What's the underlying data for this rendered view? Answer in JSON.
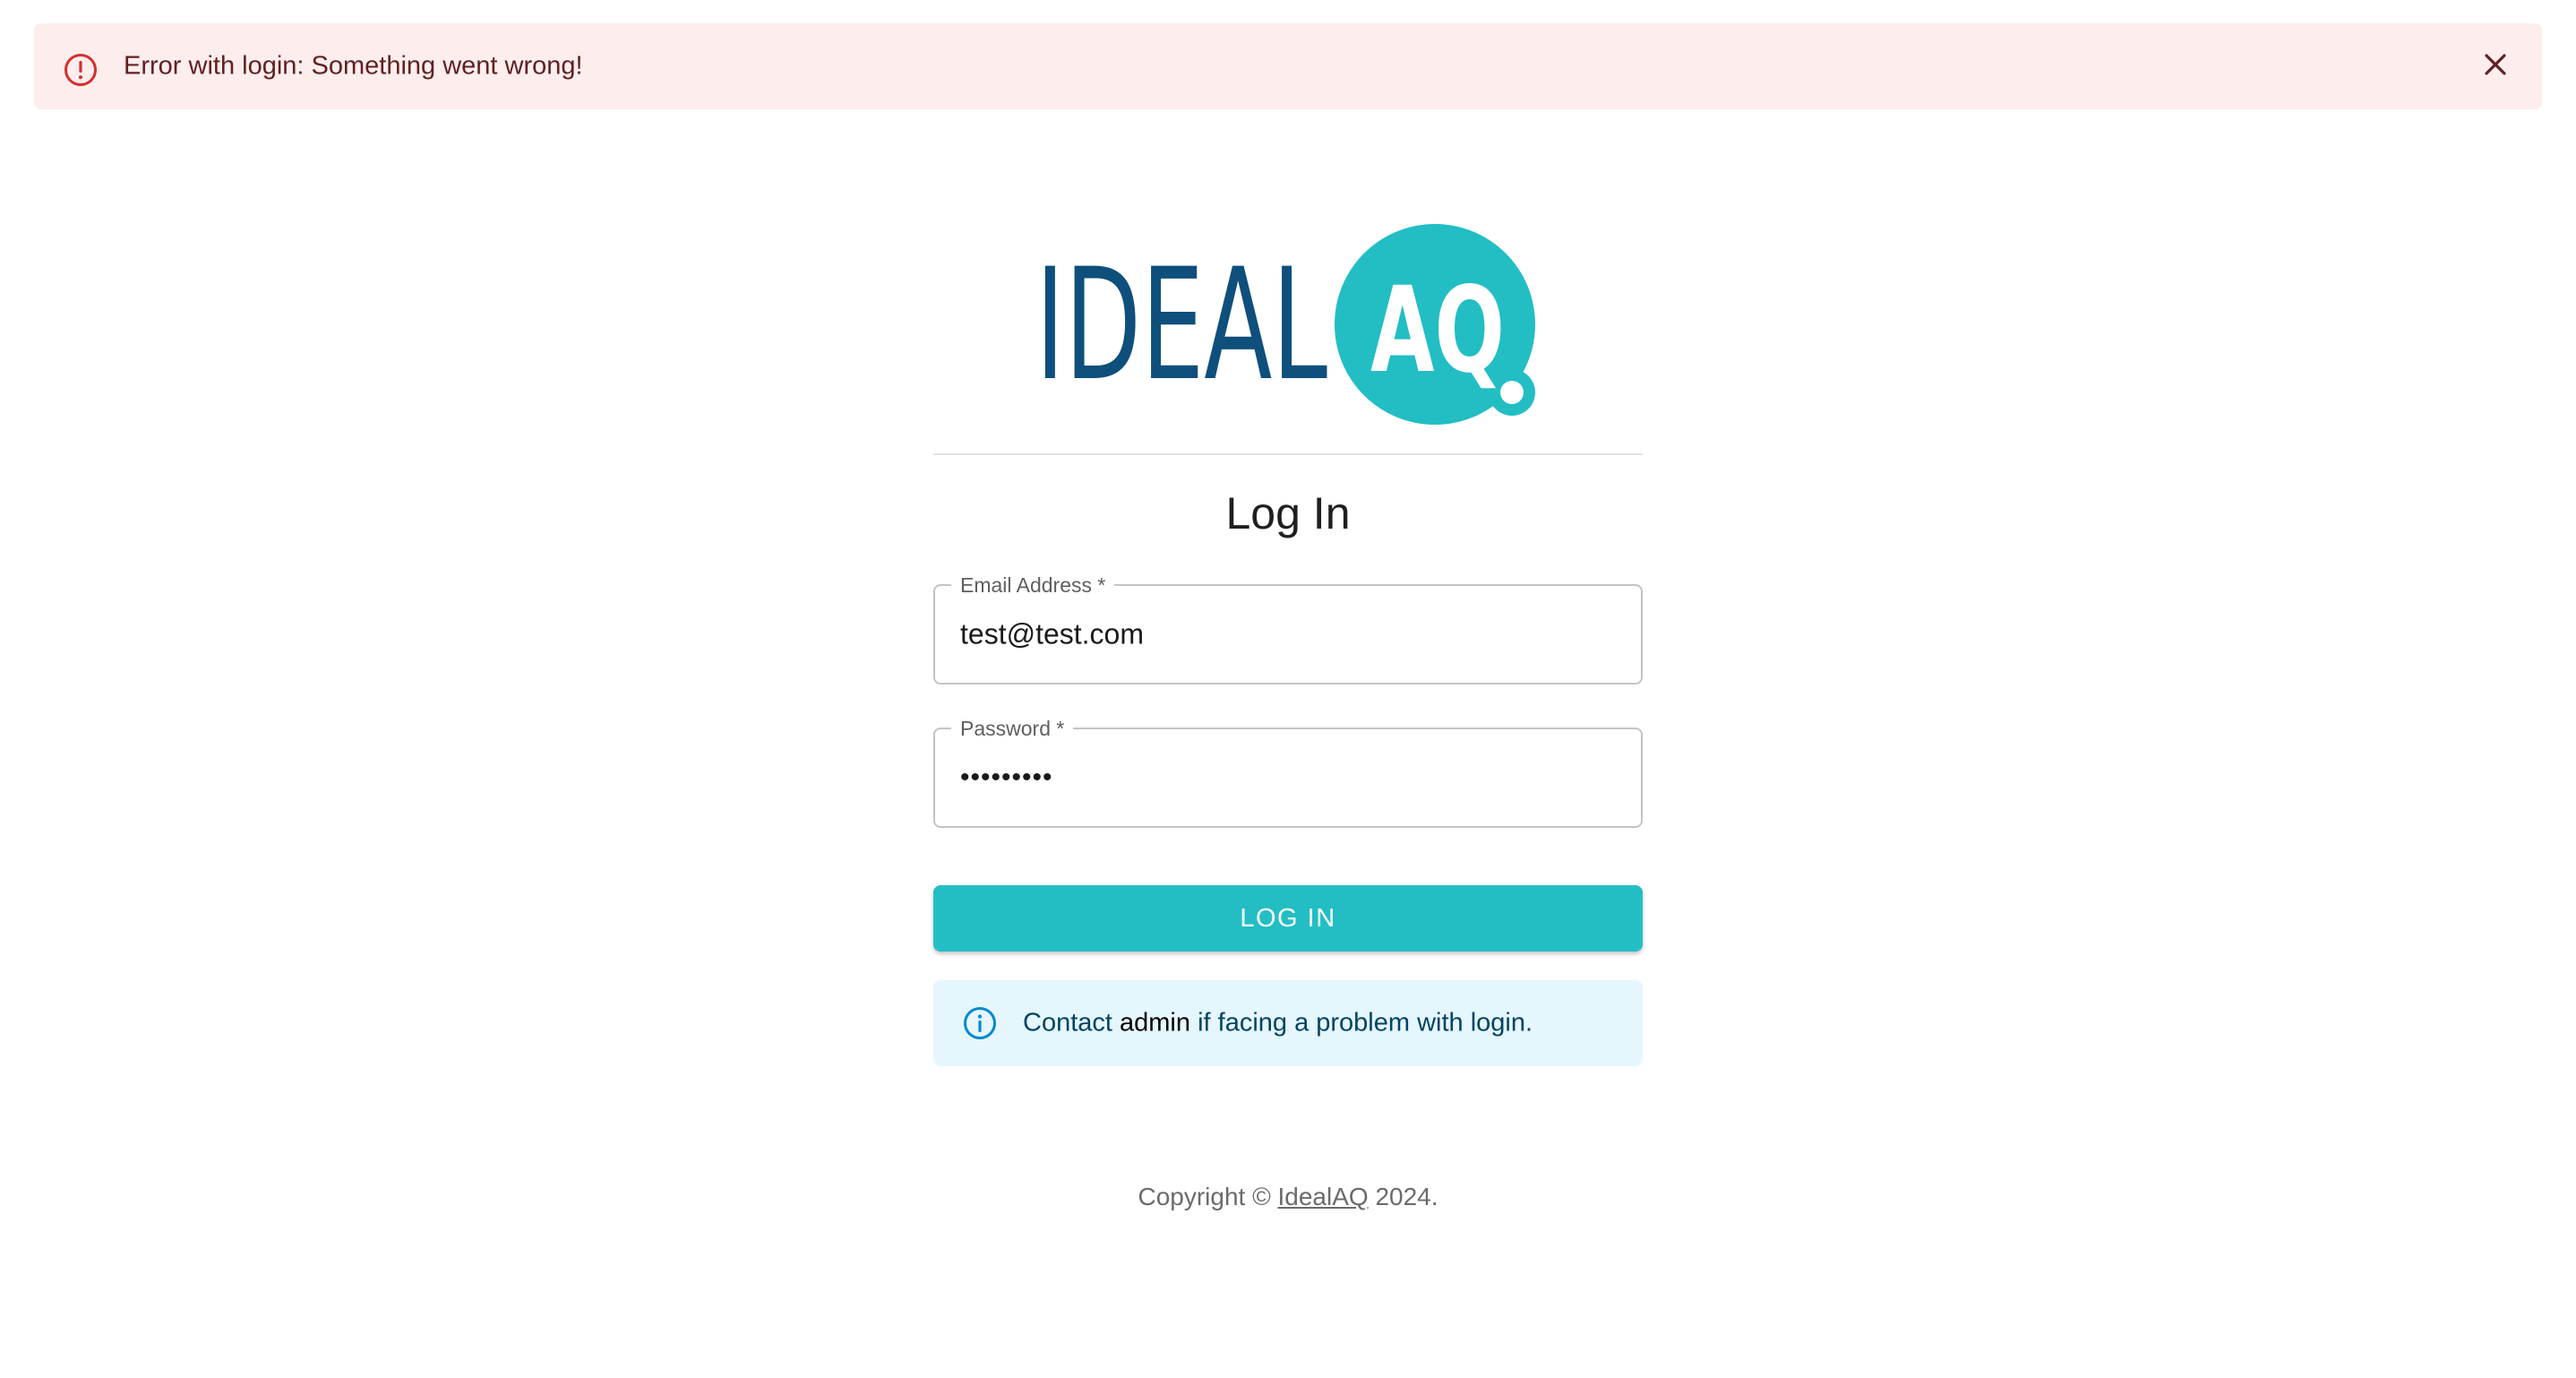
{
  "alert": {
    "message": "Error with login: Something went wrong!",
    "icon": "error-outline-icon",
    "close_icon": "close-icon",
    "color": "#d32f2f",
    "background": "#fdeded"
  },
  "logo": {
    "text_left": "IDEAL",
    "text_badge": "AQ",
    "text_color": "#0e4f7c",
    "badge_color": "#22bec4"
  },
  "form": {
    "title": "Log In",
    "email": {
      "label": "Email Address",
      "required_mark": "*",
      "value": "test@test.com"
    },
    "password": {
      "label": "Password",
      "required_mark": "*",
      "masked_value": "•••••••••"
    },
    "submit_label": "LOG IN",
    "accent_color": "#22bec4"
  },
  "info": {
    "icon": "info-outline-icon",
    "text_before": "Contact",
    "link_text": "admin",
    "text_after": "if facing a problem with login."
  },
  "footer": {
    "text_before": "Copyright ©",
    "link_text": "IdealAQ",
    "text_after": "2024."
  }
}
